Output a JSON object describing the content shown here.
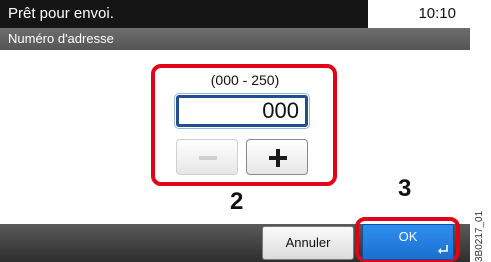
{
  "status_bar": {
    "message": "Prêt pour envoi.",
    "time": "10:10"
  },
  "title": "Numéro d'adresse",
  "address_entry": {
    "range": "(000 - 250)",
    "value": "000",
    "decrement_icon": "minus-icon",
    "increment_icon": "plus-icon"
  },
  "steps": {
    "step2": "2",
    "step3": "3"
  },
  "footer": {
    "cancel_label": "Annuler",
    "ok_label": "OK",
    "enter_icon": "enter-arrow-icon"
  },
  "figure_code": "3B0217_01",
  "colors": {
    "highlight": "#e30019",
    "ok_button": "#1a6fd0",
    "input_border": "#1f4f8f"
  }
}
